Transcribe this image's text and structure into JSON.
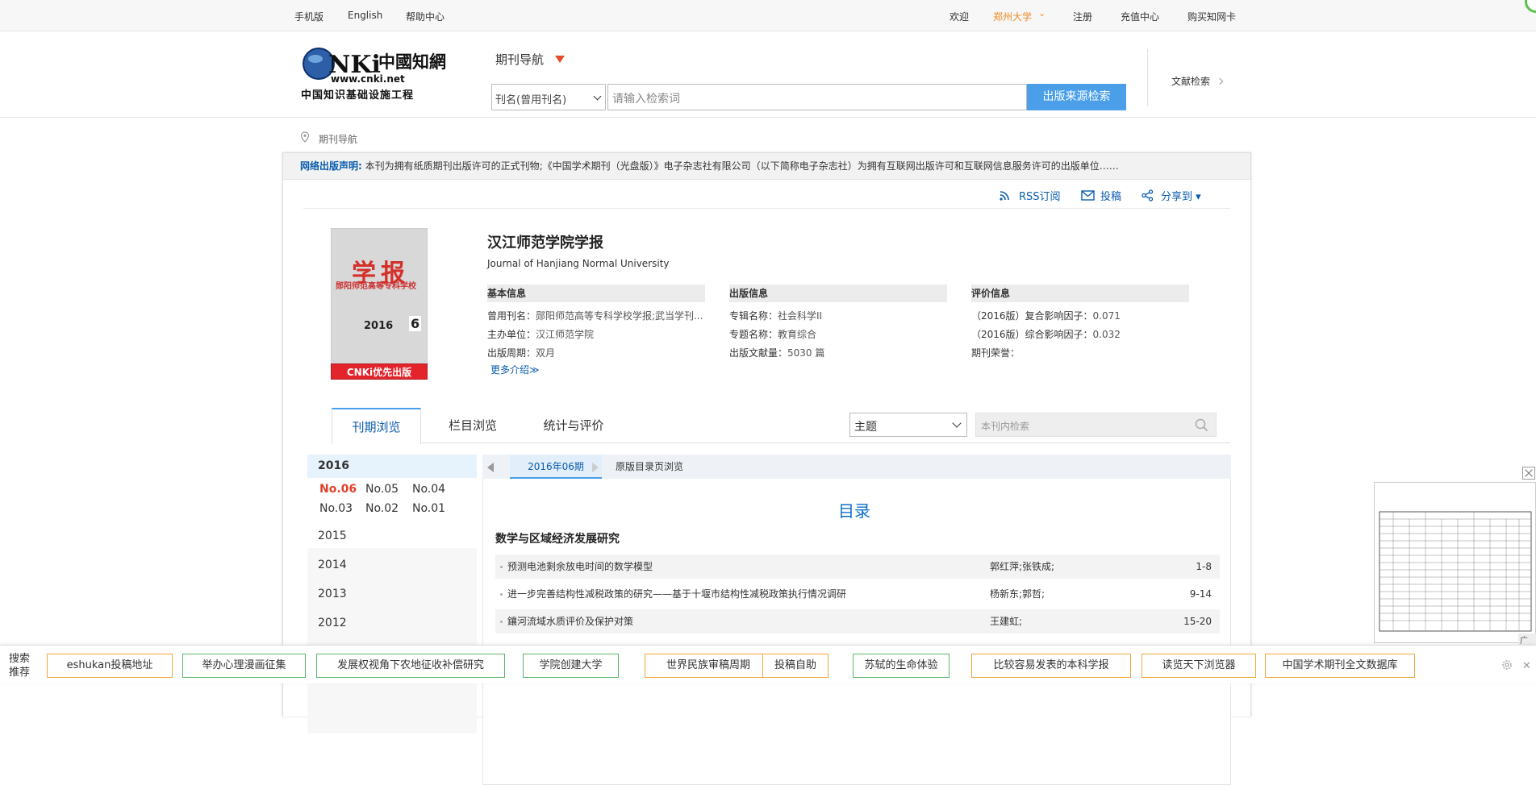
{
  "topbar": {
    "mobile": "手机版",
    "english": "English",
    "help": "帮助中心",
    "welcome": "欢迎",
    "university": "郑州大学",
    "register": "注册",
    "recharge": "充值中心",
    "buy_card": "购买知网卡"
  },
  "header": {
    "logo_text": "CNKi中国知网",
    "logo_url": "www.cnki.net",
    "logo_sub": "中国知识基础设施工程",
    "nav_label": "期刊导航",
    "field_select": "刊名(曾用刊名)",
    "search_placeholder": "请输入检索词",
    "search_button": "出版来源检索",
    "literature_search": "文献检索"
  },
  "breadcrumb": "期刊导航",
  "notice": {
    "label": "网络出版声明:",
    "text": "本刊为拥有纸质期刊出版许可的正式刊物;《中国学术期刊（光盘版）》电子杂志社有限公司（以下简称电子杂志社）为拥有互联网出版许可和互联网信息服务许可的出版单位……"
  },
  "tools": {
    "rss": "RSS订阅",
    "submit": "投稿",
    "share": "分享到 ▾"
  },
  "cover": {
    "title": "学报",
    "subtitle": "郧阳师范高等专科学校",
    "year": "2016",
    "issue": "6",
    "badge": "CNKi优先出版"
  },
  "journal": {
    "title": "汉江师范学院学报",
    "english": "Journal of Hanjiang Normal University",
    "more": "更多介绍≫"
  },
  "basic_info": {
    "heading": "基本信息",
    "rows": [
      {
        "label": "曾用刊名：",
        "value": "郧阳师范高等专科学校学报;武当学刊..."
      },
      {
        "label": "主办单位：",
        "value": "汉江师范学院"
      },
      {
        "label": "出版周期：",
        "value": "双月"
      }
    ]
  },
  "pub_info": {
    "heading": "出版信息",
    "rows": [
      {
        "label": "专辑名称：",
        "value": "社会科学II"
      },
      {
        "label": "专题名称：",
        "value": "教育综合"
      },
      {
        "label": "出版文献量：",
        "value": "5030 篇"
      }
    ]
  },
  "eval_info": {
    "heading": "评价信息",
    "rows": [
      {
        "label": "（2016版）复合影响因子：",
        "value": "0.071"
      },
      {
        "label": "（2016版）综合影响因子：",
        "value": "0.032"
      },
      {
        "label": "期刊荣誉：",
        "value": ""
      }
    ]
  },
  "tabs": [
    "刊期浏览",
    "栏目浏览",
    "统计与评价"
  ],
  "topic_select": "主题",
  "inner_search_placeholder": "本刊内检索",
  "years": {
    "current": "2016",
    "issues": [
      "No.06",
      "No.05",
      "No.04",
      "No.03",
      "No.02",
      "No.01"
    ],
    "others": [
      "2015",
      "2014",
      "2013",
      "2012"
    ]
  },
  "content": {
    "current_tab": "2016年06期",
    "original_toc": "原版目录页浏览",
    "toc_title": "目录",
    "section": "数学与区域经济发展研究",
    "articles": [
      {
        "title": "预测电池剩余放电时间的数学模型",
        "authors": "郭红萍;张铁成;",
        "pages": "1-8"
      },
      {
        "title": "进一步完善结构性减税政策的研究——基于十堰市结构性减税政策执行情况调研",
        "authors": "杨新东;郭哲;",
        "pages": "9-14"
      },
      {
        "title": "鑲河流域水质评价及保护对策",
        "authors": "王建虹;",
        "pages": "15-20"
      }
    ]
  },
  "ad": {
    "label": "广告"
  },
  "bottom": {
    "label": "搜索推荐",
    "chips": [
      "eshukan投稿地址",
      "举办心理漫画征集",
      "发展权视角下农地征收补偿研究",
      "学院创建大学",
      "世界民族审稿周期",
      "投稿自助",
      "苏轼的生命体验",
      "比较容易发表的本科学报",
      "读览天下浏览器",
      "中国学术期刊全文数据库"
    ],
    "colors": [
      "#f0a63a",
      "#5bb56a",
      "#5bb56a",
      "#5bb56a",
      "#f0a63a",
      "#f0a63a",
      "#5bb56a",
      "#f0a63a",
      "#f0a63a",
      "#f0a63a"
    ]
  }
}
